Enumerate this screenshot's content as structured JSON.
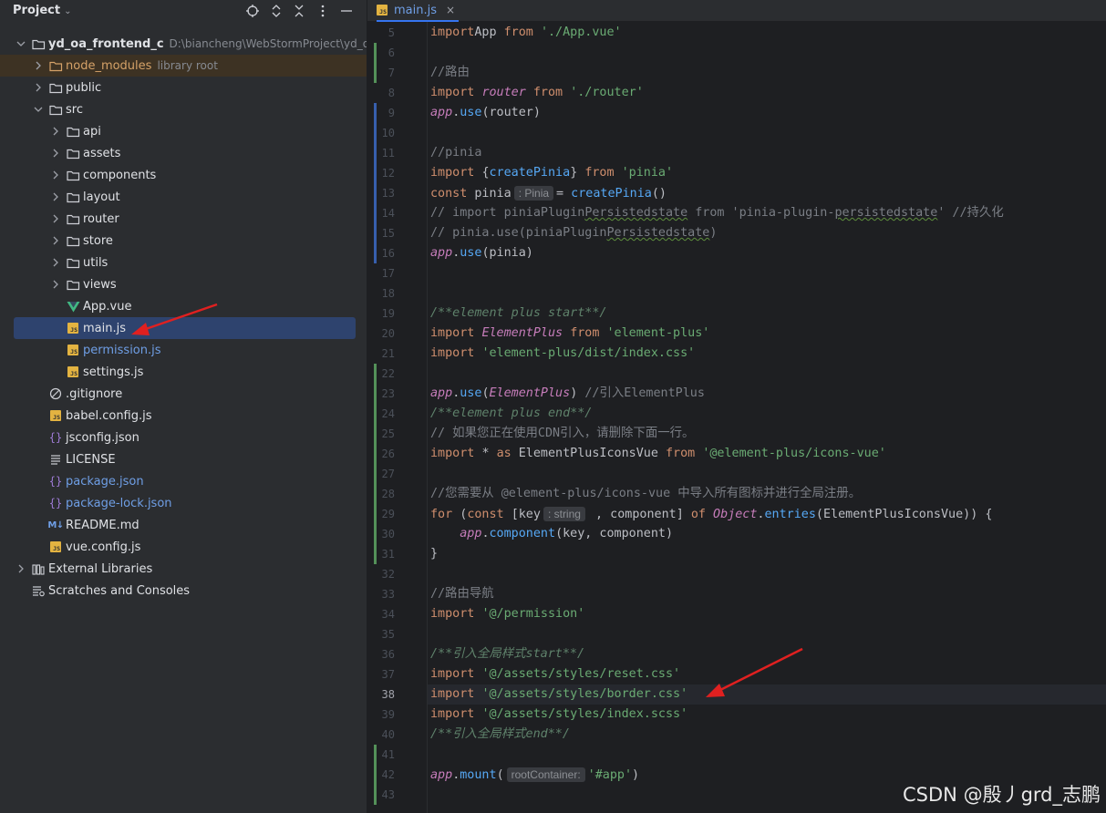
{
  "project_pane": {
    "title": "Project",
    "toolbar_icons": [
      "locate-icon",
      "expand-collapse-icon",
      "collapse-all-icon",
      "options-icon",
      "hide-icon"
    ],
    "tree": [
      {
        "label": "yd_oa_frontend_c",
        "path": "D:\\biancheng\\WebStormProject\\yd_oa_fr",
        "icon": "folder-icon",
        "expanded": true,
        "bold": true
      },
      {
        "label": "node_modules",
        "path": "library root",
        "icon": "folder-icon",
        "expanded": false
      },
      {
        "label": "public",
        "icon": "folder-icon",
        "expanded": false
      },
      {
        "label": "src",
        "icon": "folder-icon",
        "expanded": true
      },
      {
        "label": "api",
        "icon": "folder-icon",
        "expanded": false
      },
      {
        "label": "assets",
        "icon": "folder-icon",
        "expanded": false
      },
      {
        "label": "components",
        "icon": "folder-icon",
        "expanded": false
      },
      {
        "label": "layout",
        "icon": "folder-icon",
        "expanded": false
      },
      {
        "label": "router",
        "icon": "folder-icon",
        "expanded": false
      },
      {
        "label": "store",
        "icon": "folder-icon",
        "expanded": false
      },
      {
        "label": "utils",
        "icon": "folder-icon",
        "expanded": false
      },
      {
        "label": "views",
        "icon": "folder-icon",
        "expanded": false
      },
      {
        "label": "App.vue",
        "icon": "vue-file-icon"
      },
      {
        "label": "main.js",
        "icon": "js-file-icon",
        "selected": true
      },
      {
        "label": "permission.js",
        "icon": "js-file-icon",
        "modified": true
      },
      {
        "label": "settings.js",
        "icon": "js-file-icon"
      },
      {
        "label": ".gitignore",
        "icon": "ignore-file-icon"
      },
      {
        "label": "babel.config.js",
        "icon": "js-file-icon"
      },
      {
        "label": "jsconfig.json",
        "icon": "json-file-icon"
      },
      {
        "label": "LICENSE",
        "icon": "text-file-icon"
      },
      {
        "label": "package.json",
        "icon": "json-file-icon",
        "modified": true
      },
      {
        "label": "package-lock.json",
        "icon": "json-file-icon",
        "modified": true
      },
      {
        "label": "README.md",
        "icon": "markdown-file-icon"
      },
      {
        "label": "vue.config.js",
        "icon": "js-file-icon"
      },
      {
        "label": "External Libraries",
        "icon": "library-icon",
        "expanded": false
      },
      {
        "label": "Scratches and Consoles",
        "icon": "scratches-icon"
      }
    ]
  },
  "editor": {
    "tab": {
      "label": "main.js",
      "close": "×",
      "icon": "js-file-icon"
    },
    "current_line": "38",
    "lines": [
      {
        "num": "5",
        "tokens": [
          [
            "kw",
            "import"
          ],
          [
            "",
            "App "
          ],
          [
            "kw",
            "from "
          ],
          [
            "str",
            "'./App.vue'"
          ]
        ]
      },
      {
        "num": "6",
        "tokens": []
      },
      {
        "num": "7",
        "tokens": [
          [
            "cmt",
            "//路由"
          ]
        ]
      },
      {
        "num": "8",
        "tokens": [
          [
            "kw",
            "import "
          ],
          [
            "pv",
            "router "
          ],
          [
            "kw",
            "from "
          ],
          [
            "str",
            "'./router'"
          ]
        ]
      },
      {
        "num": "9",
        "tokens": [
          [
            "pv",
            "app"
          ],
          [
            "",
            "."
          ],
          [
            "fn",
            "use"
          ],
          [
            "",
            "(router)"
          ]
        ]
      },
      {
        "num": "10",
        "tokens": []
      },
      {
        "num": "11",
        "tokens": [
          [
            "cmt",
            "//pinia"
          ]
        ]
      },
      {
        "num": "12",
        "tokens": [
          [
            "kw",
            "import "
          ],
          [
            "",
            "{"
          ],
          [
            "fn",
            "createPinia"
          ],
          [
            "",
            "} "
          ],
          [
            "kw",
            "from "
          ],
          [
            "str",
            "'pinia'"
          ]
        ]
      },
      {
        "num": "13",
        "tokens": [
          [
            "kw",
            "const "
          ],
          [
            "",
            "pinia"
          ],
          [
            "hint",
            ": Pinia"
          ],
          [
            "",
            "= "
          ],
          [
            "fn",
            "createPinia"
          ],
          [
            "",
            "()"
          ]
        ]
      },
      {
        "num": "14",
        "tokens": [
          [
            "cmt",
            "// import piniaPlugin"
          ],
          [
            "cmt squig",
            "Persistedstate"
          ],
          [
            "cmt",
            " from 'pinia-plugin-"
          ],
          [
            "cmt squig",
            "persistedstate"
          ],
          [
            "cmt",
            "' //持久化"
          ]
        ]
      },
      {
        "num": "15",
        "tokens": [
          [
            "cmt",
            "// pinia.use(piniaPlugin"
          ],
          [
            "cmt squig",
            "Persistedstate"
          ],
          [
            "cmt",
            ")"
          ]
        ]
      },
      {
        "num": "16",
        "tokens": [
          [
            "pv",
            "app"
          ],
          [
            "",
            "."
          ],
          [
            "fn",
            "use"
          ],
          [
            "",
            "(pinia)"
          ]
        ]
      },
      {
        "num": "17",
        "tokens": []
      },
      {
        "num": "18",
        "tokens": []
      },
      {
        "num": "19",
        "tokens": [
          [
            "doc",
            "/**element plus start**/"
          ]
        ]
      },
      {
        "num": "20",
        "tokens": [
          [
            "kw",
            "import "
          ],
          [
            "cls",
            "ElementPlus "
          ],
          [
            "kw",
            "from "
          ],
          [
            "str",
            "'element-plus'"
          ]
        ]
      },
      {
        "num": "21",
        "tokens": [
          [
            "kw",
            "import "
          ],
          [
            "str",
            "'element-plus/dist/index.css'"
          ]
        ]
      },
      {
        "num": "22",
        "tokens": []
      },
      {
        "num": "23",
        "tokens": [
          [
            "pv",
            "app"
          ],
          [
            "",
            "."
          ],
          [
            "fn",
            "use"
          ],
          [
            "",
            "("
          ],
          [
            "cls",
            "ElementPlus"
          ],
          [
            "",
            ") "
          ],
          [
            "cmt",
            "//引入ElementPlus"
          ]
        ]
      },
      {
        "num": "24",
        "tokens": [
          [
            "doc",
            "/**element plus end**/"
          ]
        ]
      },
      {
        "num": "25",
        "tokens": [
          [
            "cmt",
            "// 如果您正在使用CDN引入，请删除下面一行。"
          ]
        ]
      },
      {
        "num": "26",
        "tokens": [
          [
            "kw",
            "import "
          ],
          [
            "",
            "* "
          ],
          [
            "kw",
            "as "
          ],
          [
            "",
            "ElementPlusIconsVue "
          ],
          [
            "kw",
            "from "
          ],
          [
            "str",
            "'@element-plus/icons-vue'"
          ]
        ]
      },
      {
        "num": "27",
        "tokens": []
      },
      {
        "num": "28",
        "tokens": [
          [
            "cmt",
            "//您需要从 @element-plus/icons-vue 中导入所有图标并进行全局注册。"
          ]
        ]
      },
      {
        "num": "29",
        "tokens": [
          [
            "kw",
            "for "
          ],
          [
            "",
            "("
          ],
          [
            "kw",
            "const "
          ],
          [
            "",
            "[key"
          ],
          [
            "hint",
            ": string"
          ],
          [
            "",
            " , component] "
          ],
          [
            "kw",
            "of "
          ],
          [
            "cls",
            "Object"
          ],
          [
            "",
            "."
          ],
          [
            "fn",
            "entries"
          ],
          [
            "",
            "(ElementPlusIconsVue)) {"
          ]
        ]
      },
      {
        "num": "30",
        "tokens": [
          [
            "",
            "    "
          ],
          [
            "pv",
            "app"
          ],
          [
            "",
            "."
          ],
          [
            "fn",
            "component"
          ],
          [
            "",
            "(key, component)"
          ]
        ]
      },
      {
        "num": "31",
        "tokens": [
          [
            "",
            "}"
          ]
        ]
      },
      {
        "num": "32",
        "tokens": []
      },
      {
        "num": "33",
        "tokens": [
          [
            "cmt",
            "//路由导航"
          ]
        ]
      },
      {
        "num": "34",
        "tokens": [
          [
            "kw",
            "import "
          ],
          [
            "str",
            "'@/permission'"
          ]
        ]
      },
      {
        "num": "35",
        "tokens": []
      },
      {
        "num": "36",
        "tokens": [
          [
            "doc",
            "/**引入全局样式start**/"
          ]
        ]
      },
      {
        "num": "37",
        "tokens": [
          [
            "kw",
            "import "
          ],
          [
            "str",
            "'@/assets/styles/reset.css'"
          ]
        ]
      },
      {
        "num": "38",
        "tokens": [
          [
            "kw",
            "import "
          ],
          [
            "str",
            "'@/assets/styles/border.css'"
          ]
        ]
      },
      {
        "num": "39",
        "tokens": [
          [
            "kw",
            "import "
          ],
          [
            "str",
            "'@/assets/styles/index.scss'"
          ]
        ]
      },
      {
        "num": "40",
        "tokens": [
          [
            "doc",
            "/**引入全局样式end**/"
          ]
        ]
      },
      {
        "num": "41",
        "tokens": []
      },
      {
        "num": "42",
        "tokens": [
          [
            "pv",
            "app"
          ],
          [
            "",
            "."
          ],
          [
            "fn",
            "mount"
          ],
          [
            "",
            "("
          ],
          [
            "hint",
            "rootContainer:"
          ],
          [
            "str",
            "'#app'"
          ],
          [
            "",
            ")"
          ]
        ]
      },
      {
        "num": "43",
        "tokens": []
      }
    ]
  },
  "watermark": "CSDN @殷丿grd_志鹏",
  "colors": {
    "accent": "#3574f0",
    "annotation_arrow": "#e02020",
    "vcs_added": "#549159",
    "vcs_modified": "#375fad"
  }
}
